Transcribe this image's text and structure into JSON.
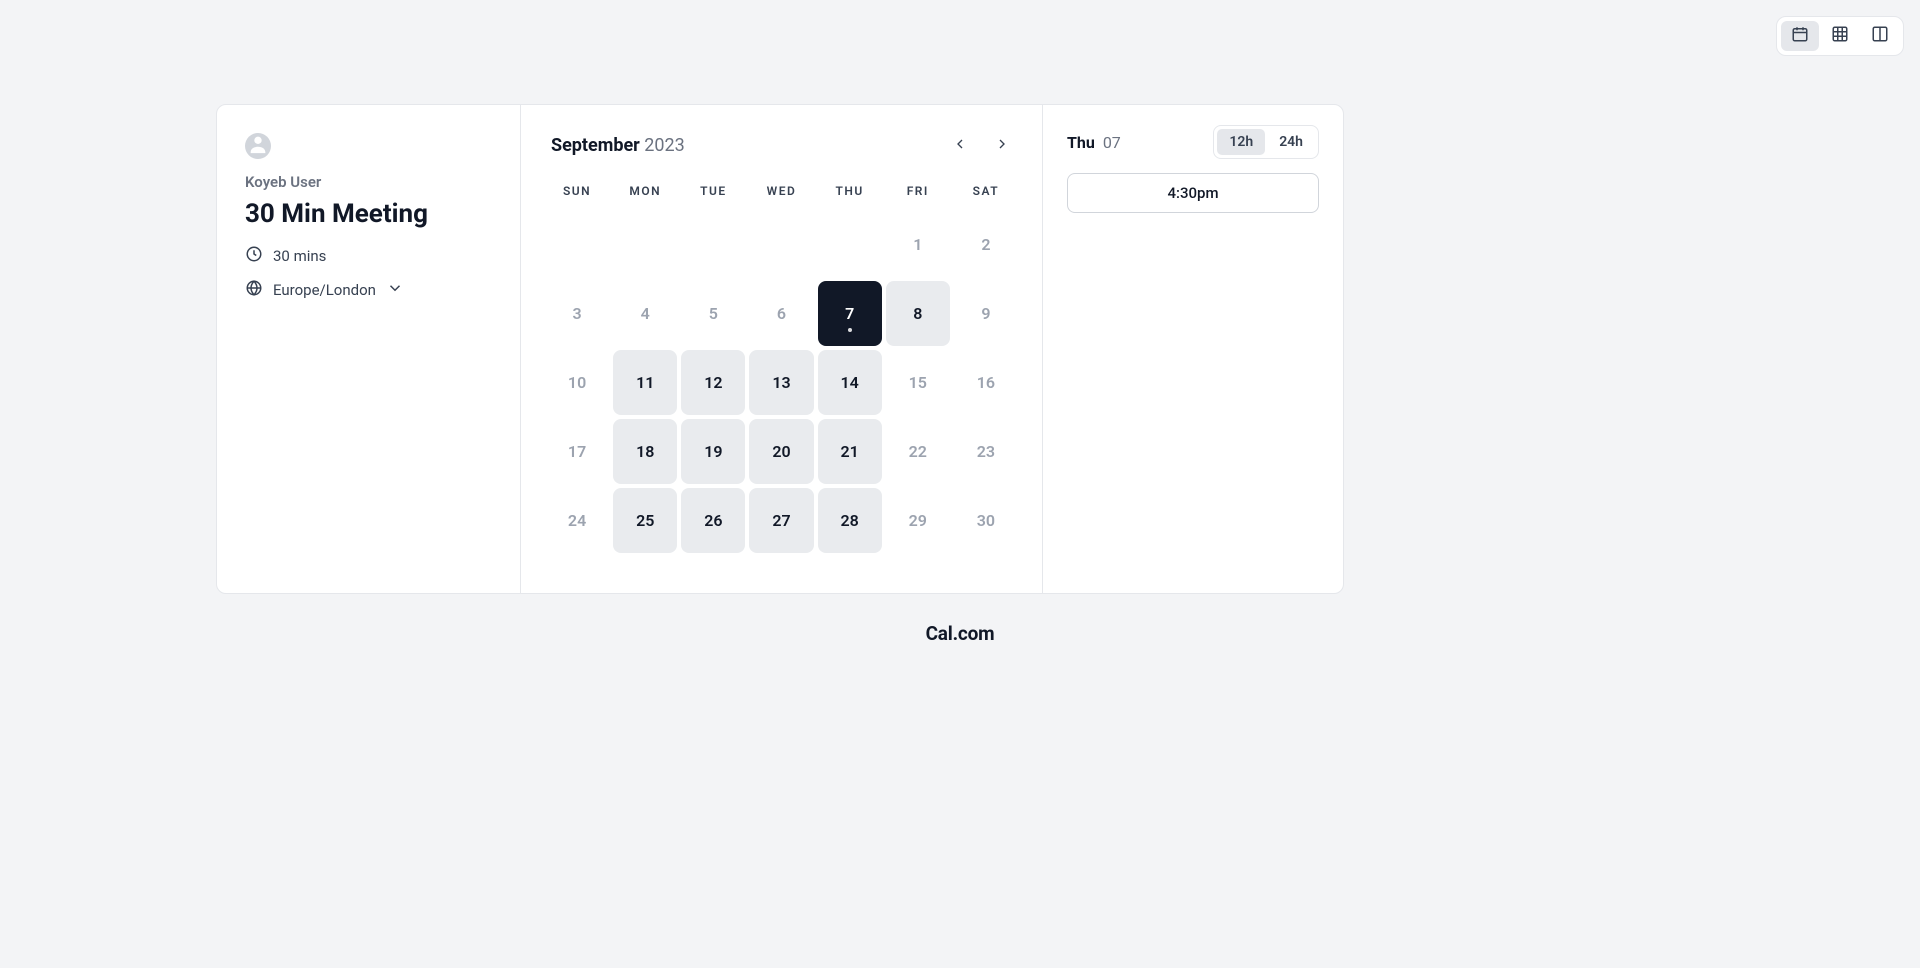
{
  "viewToggle": {
    "options": [
      {
        "id": "calendar",
        "active": true
      },
      {
        "id": "grid",
        "active": false
      },
      {
        "id": "columns",
        "active": false
      }
    ]
  },
  "event": {
    "hostName": "Koyeb User",
    "title": "30 Min Meeting",
    "duration": "30 mins",
    "timezone": "Europe/London"
  },
  "calendar": {
    "month": "September",
    "year": "2023",
    "dows": [
      "SUN",
      "MON",
      "TUE",
      "WED",
      "THU",
      "FRI",
      "SAT"
    ],
    "days": [
      {
        "label": "",
        "state": "empty"
      },
      {
        "label": "",
        "state": "empty"
      },
      {
        "label": "",
        "state": "empty"
      },
      {
        "label": "",
        "state": "empty"
      },
      {
        "label": "",
        "state": "empty"
      },
      {
        "label": "1",
        "state": "disabled"
      },
      {
        "label": "2",
        "state": "disabled"
      },
      {
        "label": "3",
        "state": "disabled"
      },
      {
        "label": "4",
        "state": "disabled"
      },
      {
        "label": "5",
        "state": "disabled"
      },
      {
        "label": "6",
        "state": "disabled"
      },
      {
        "label": "7",
        "state": "selected",
        "today": true
      },
      {
        "label": "8",
        "state": "available"
      },
      {
        "label": "9",
        "state": "disabled"
      },
      {
        "label": "10",
        "state": "disabled"
      },
      {
        "label": "11",
        "state": "available"
      },
      {
        "label": "12",
        "state": "available"
      },
      {
        "label": "13",
        "state": "available"
      },
      {
        "label": "14",
        "state": "available"
      },
      {
        "label": "15",
        "state": "disabled"
      },
      {
        "label": "16",
        "state": "disabled"
      },
      {
        "label": "17",
        "state": "disabled"
      },
      {
        "label": "18",
        "state": "available"
      },
      {
        "label": "19",
        "state": "available"
      },
      {
        "label": "20",
        "state": "available"
      },
      {
        "label": "21",
        "state": "available"
      },
      {
        "label": "22",
        "state": "disabled"
      },
      {
        "label": "23",
        "state": "disabled"
      },
      {
        "label": "24",
        "state": "disabled"
      },
      {
        "label": "25",
        "state": "available"
      },
      {
        "label": "26",
        "state": "available"
      },
      {
        "label": "27",
        "state": "available"
      },
      {
        "label": "28",
        "state": "available"
      },
      {
        "label": "29",
        "state": "disabled"
      },
      {
        "label": "30",
        "state": "disabled"
      }
    ]
  },
  "slots": {
    "selectedDayShort": "Thu",
    "selectedDayNum": "07",
    "hourFormat": {
      "options": [
        {
          "label": "12h",
          "active": true
        },
        {
          "label": "24h",
          "active": false
        }
      ]
    },
    "times": [
      "4:30pm"
    ]
  },
  "brand": "Cal.com"
}
